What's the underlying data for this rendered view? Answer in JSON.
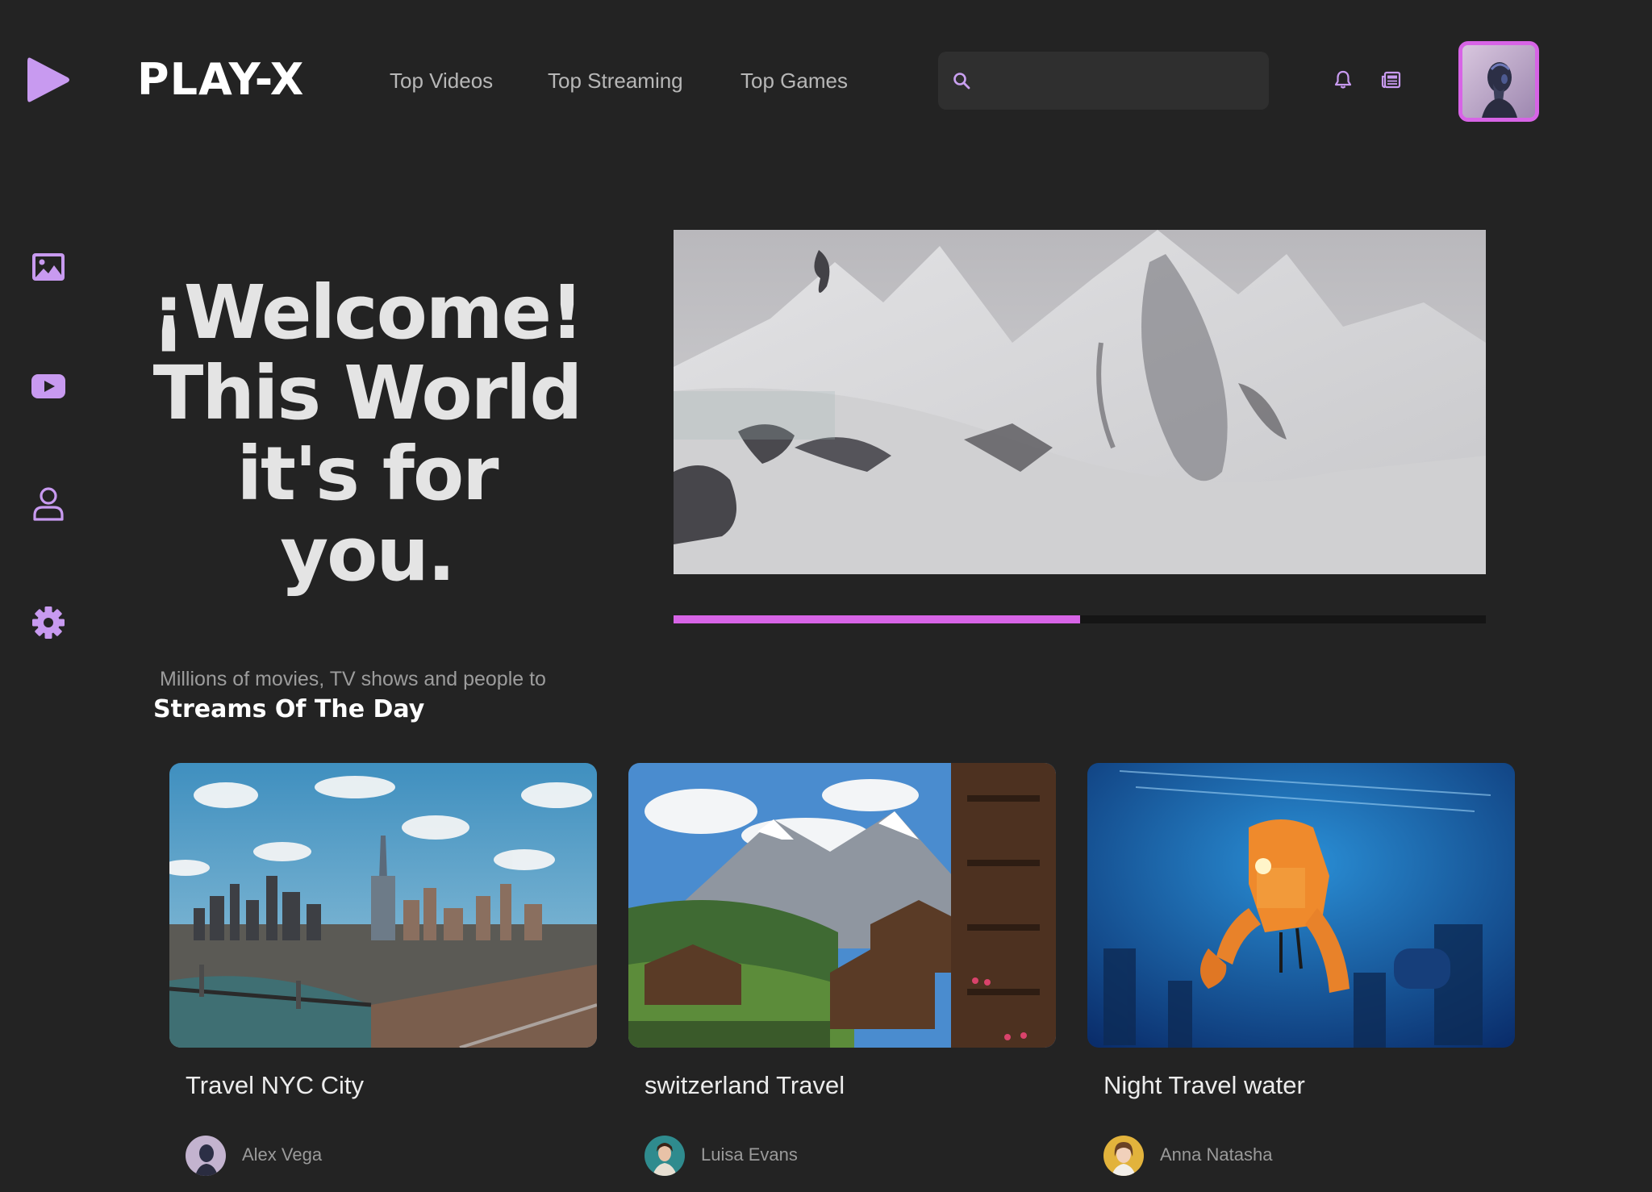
{
  "header": {
    "brand": "PLAY-X",
    "nav": [
      {
        "label": "Top Videos"
      },
      {
        "label": "Top Streaming"
      },
      {
        "label": "Top Games"
      }
    ],
    "search": {
      "value": "",
      "placeholder": ""
    },
    "icons": [
      "play-logo-icon",
      "search-icon",
      "bell-icon",
      "newspaper-icon"
    ]
  },
  "sidebar": {
    "icons": [
      "image-icon",
      "youtube-icon",
      "user-icon",
      "gear-icon"
    ]
  },
  "hero": {
    "lines": [
      "¡Welcome!",
      "This World",
      "it's for",
      "you."
    ],
    "subtitle": "Millions of movies, TV shows and people to",
    "section_title": "Streams Of The Day"
  },
  "video": {
    "progress": 0.5
  },
  "cards": [
    {
      "title": "Travel NYC City",
      "author": "Alex Vega"
    },
    {
      "title": "switzerland Travel",
      "author": "Luisa Evans"
    },
    {
      "title": "Night Travel water",
      "author": "Anna Natasha"
    }
  ],
  "colors": {
    "background": "#232323",
    "accent": "#d764e6",
    "icon": "#c89af0",
    "text": "#e7e7e7"
  }
}
